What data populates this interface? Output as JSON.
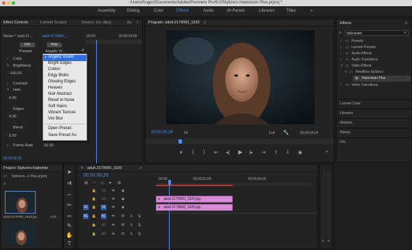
{
  "window": {
    "title": "/Users/hugoc/Documents/Adobe/Premiere Pro/9.0/Stylizers-Halovision Plus.prproj *"
  },
  "workspaces": [
    "Assembly",
    "Editing",
    "Color",
    "Effects",
    "Audio",
    "All Panels",
    "Libraries",
    "Titles"
  ],
  "effect_controls": {
    "tabs": [
      "Effect Controls",
      "Lumetri Scopes",
      "Source: (no clips)",
      "Au"
    ],
    "master_label": "Master * adult-21...",
    "clip_label": "adult-2179060_...",
    "ruler_time": "00;00;04;00",
    "ruler_time2": ";00;00",
    "info_button": "Info",
    "help_button": "Help",
    "presets_label": "Presets",
    "presets_value": "Angelic Vi...",
    "params": [
      {
        "name": "Color",
        "value": ""
      },
      {
        "name": "Brightness",
        "value": ""
      },
      {
        "name": "",
        "value": "-100.00"
      },
      {
        "name": "Contrast",
        "value": ""
      },
      {
        "name": "Halo",
        "value": ""
      },
      {
        "name": "",
        "value": "0.00"
      },
      {
        "name": "Edges",
        "value": ""
      },
      {
        "name": "",
        "value": "0.00"
      },
      {
        "name": "Blend",
        "value": ""
      },
      {
        "name": "",
        "value": "0.00"
      },
      {
        "name": "Frame Rate",
        "value": "30.00"
      }
    ],
    "timecode": "00;00;00;26"
  },
  "preset_menu": {
    "items": [
      "Angelic Vision",
      "Bright Edges",
      "Cotton",
      "Edgy Blobs",
      "Glowing Edges",
      "Heaven",
      "Noir Abstract",
      "Reset to None",
      "Soft Halos",
      "Vibrant Texture",
      "Vivi Blur"
    ],
    "selected": "Angelic Vision",
    "actions": [
      "Open Preset:",
      "Save Preset As:"
    ]
  },
  "program": {
    "tab": "Program: adult-2179060_1920",
    "timecode": "00;00;00;26",
    "fit": "Fit",
    "full": "Full",
    "duration": "00;00;04;29"
  },
  "effects_panel": {
    "title": "Effects",
    "search_value": "halovision",
    "tree": [
      {
        "label": "Presets",
        "indent": 0
      },
      {
        "label": "Lumetri Presets",
        "indent": 0
      },
      {
        "label": "Audio Effects",
        "indent": 0
      },
      {
        "label": "Audio Transitions",
        "indent": 0
      },
      {
        "label": "Video Effects",
        "indent": 0
      },
      {
        "label": "NewBlue Stylizers",
        "indent": 1
      },
      {
        "label": "Halovision Plus",
        "indent": 2
      },
      {
        "label": "Video Transitions",
        "indent": 0
      }
    ],
    "sections": [
      "Lumetri Color",
      "Libraries",
      "Markers",
      "History",
      "Info"
    ]
  },
  "project": {
    "tab": "Project: Stylizers-Halovisio",
    "file": "Stylizers...n Plus.prproj",
    "item1": {
      "name": "adult-2179060_1920.jpg",
      "dur": "4;29"
    },
    "item2": {
      "name": "adult-2179060_1920",
      "dur": "4;29"
    }
  },
  "timeline": {
    "tab": "adult-2179060_1920",
    "timecode": "00;00;00;26",
    "ruler": [
      "00;00",
      "00;00;02;00",
      "00;00;04;00"
    ],
    "tracks": [
      "V3",
      "V2",
      "V1",
      "A1",
      "A2",
      "A3"
    ],
    "clips": [
      {
        "name": "adult-2179060_1920.jpg",
        "track": "V2",
        "color": "#d68bd6"
      },
      {
        "name": "adult-2179060_1920.jpg",
        "track": "V1",
        "color": "#d68bd6"
      }
    ]
  },
  "meter_labels": {
    "left": "S",
    "right": "S"
  }
}
